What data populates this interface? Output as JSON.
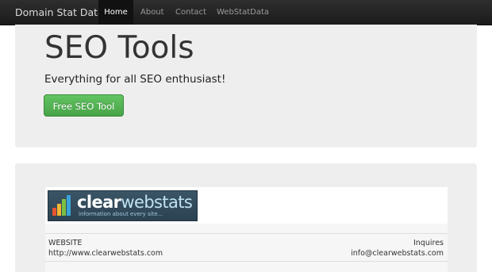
{
  "nav": {
    "brand": "Domain Stat Data",
    "items": [
      {
        "label": "Home"
      },
      {
        "label": "About"
      },
      {
        "label": "Contact"
      },
      {
        "label": "WebStatData"
      }
    ]
  },
  "hero": {
    "title": "SEO Tools",
    "subtitle": "Everything for all SEO enthusiast!",
    "button_label": "Free SEO Tool"
  },
  "listing": {
    "logo": {
      "word_part1": "clear",
      "word_part2": "webstats",
      "tagline": "information about every site..."
    },
    "website_label": "WEBSITE",
    "website_url": "http://www.clearwebstats.com",
    "inquires_label": "Inquires",
    "inquires_email": "info@clearwebstats.com"
  },
  "colors": {
    "navbar": "#1b1b1b",
    "hero_bg": "#eeeeee",
    "button_green": "#51a351"
  }
}
